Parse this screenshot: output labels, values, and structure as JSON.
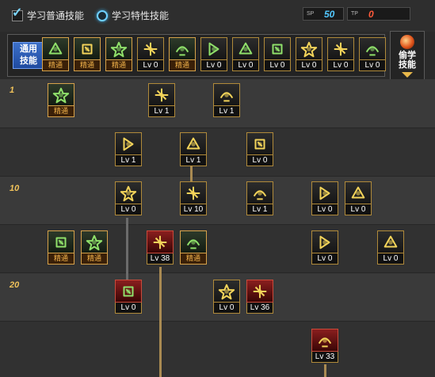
{
  "top": {
    "normal_skills_label": "学习普通技能",
    "trait_skills_label": "学习特性技能",
    "sp": {
      "label": "SP",
      "value": "50",
      "color": "#52c8ff"
    },
    "tp": {
      "label": "TP",
      "value": "0",
      "color": "#ff5a3a"
    }
  },
  "skillbar": {
    "general_label_line1": "通用",
    "general_label_line2": "技能",
    "skills": [
      {
        "name": "general-skill-1",
        "level": "精通",
        "master": true,
        "icon_color": "#8fe06a"
      },
      {
        "name": "general-skill-2",
        "level": "精通",
        "master": true,
        "icon_color": "#f2d35a"
      },
      {
        "name": "general-skill-3",
        "level": "精通",
        "master": true,
        "icon_color": "#8fe06a"
      },
      {
        "name": "general-skill-4",
        "level": "Lv 0",
        "master": false,
        "icon_color": "#f2d35a"
      },
      {
        "name": "general-skill-5",
        "level": "精通",
        "master": true,
        "icon_color": "#8fe06a"
      },
      {
        "name": "general-skill-6",
        "level": "Lv 0",
        "master": false,
        "icon_color": "#8fe06a"
      },
      {
        "name": "general-skill-7",
        "level": "Lv 0",
        "master": false,
        "icon_color": "#8fe06a"
      },
      {
        "name": "general-skill-8",
        "level": "Lv 0",
        "master": false,
        "icon_color": "#8fe06a"
      },
      {
        "name": "general-skill-9",
        "level": "Lv 0",
        "master": false,
        "icon_color": "#f2d35a"
      },
      {
        "name": "general-skill-10",
        "level": "Lv 0",
        "master": false,
        "icon_color": "#f2d35a"
      },
      {
        "name": "general-skill-11",
        "level": "Lv 0",
        "master": false,
        "icon_color": "#8fe06a"
      }
    ],
    "steal_label_line1": "偷学",
    "steal_label_line2": "技能"
  },
  "tree": {
    "level_markers": [
      "1",
      "10",
      "20"
    ],
    "skills": [
      {
        "name": "tree-skill-r1-a",
        "level": "精通",
        "master": true,
        "icon_color": "#8fe06a"
      },
      {
        "name": "tree-skill-r1-b",
        "level": "Lv 1",
        "master": false,
        "icon_color": "#f2d35a"
      },
      {
        "name": "tree-skill-r1-c",
        "level": "Lv 1",
        "master": false,
        "icon_color": "#f2d35a"
      },
      {
        "name": "tree-skill-r2-a",
        "level": "Lv 1",
        "master": false,
        "icon_color": "#f2d35a"
      },
      {
        "name": "tree-skill-r2-b",
        "level": "Lv 1",
        "master": false,
        "icon_color": "#f2d35a"
      },
      {
        "name": "tree-skill-r2-c",
        "level": "Lv 0",
        "master": false,
        "icon_color": "#f2d35a"
      },
      {
        "name": "tree-skill-r3-a",
        "level": "Lv 0",
        "master": false,
        "icon_color": "#f2d35a"
      },
      {
        "name": "tree-skill-r3-b",
        "level": "Lv 10",
        "master": false,
        "icon_color": "#f2d35a"
      },
      {
        "name": "tree-skill-r3-c",
        "level": "Lv 1",
        "master": false,
        "icon_color": "#f2d35a"
      },
      {
        "name": "tree-skill-r3-d",
        "level": "Lv 0",
        "master": false,
        "icon_color": "#f2d35a"
      },
      {
        "name": "tree-skill-r3-e",
        "level": "Lv 0",
        "master": false,
        "icon_color": "#f2d35a"
      },
      {
        "name": "tree-skill-r4-a",
        "level": "精通",
        "master": true,
        "icon_color": "#8fe06a"
      },
      {
        "name": "tree-skill-r4-b",
        "level": "精通",
        "master": true,
        "icon_color": "#8fe06a"
      },
      {
        "name": "tree-skill-r4-c",
        "level": "Lv 38",
        "master": false,
        "red": true,
        "icon_color": "#f2d35a"
      },
      {
        "name": "tree-skill-r4-d",
        "level": "精通",
        "master": true,
        "icon_color": "#8fe06a"
      },
      {
        "name": "tree-skill-r4-e",
        "level": "Lv 0",
        "master": false,
        "icon_color": "#f2d35a"
      },
      {
        "name": "tree-skill-r4-f",
        "level": "Lv 0",
        "master": false,
        "icon_color": "#f2d35a"
      },
      {
        "name": "tree-skill-r5-a",
        "level": "Lv 0",
        "master": false,
        "red": true,
        "icon_color": "#8fe06a"
      },
      {
        "name": "tree-skill-r5-b",
        "level": "Lv 0",
        "master": false,
        "icon_color": "#f2d35a"
      },
      {
        "name": "tree-skill-r5-c",
        "level": "Lv 36",
        "master": false,
        "red": true,
        "icon_color": "#f2d35a"
      },
      {
        "name": "tree-skill-r6-a",
        "level": "Lv 33",
        "master": false,
        "red": true,
        "icon_color": "#f2d35a"
      }
    ]
  }
}
